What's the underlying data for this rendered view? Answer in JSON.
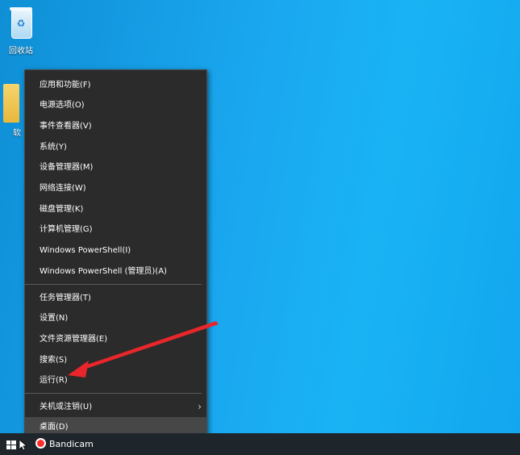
{
  "desktop": {
    "icons": [
      {
        "label": "回收站",
        "icon": "recycle-bin-icon"
      },
      {
        "label": "软",
        "icon": "folder-icon"
      }
    ]
  },
  "context_menu": {
    "items": [
      {
        "label": "应用和功能(F)"
      },
      {
        "label": "电源选项(O)"
      },
      {
        "label": "事件查看器(V)"
      },
      {
        "label": "系统(Y)"
      },
      {
        "label": "设备管理器(M)"
      },
      {
        "label": "网络连接(W)"
      },
      {
        "label": "磁盘管理(K)"
      },
      {
        "label": "计算机管理(G)"
      },
      {
        "label": "Windows PowerShell(I)"
      },
      {
        "label": "Windows PowerShell (管理员)(A)"
      },
      {
        "label": "任务管理器(T)"
      },
      {
        "label": "设置(N)"
      },
      {
        "label": "文件资源管理器(E)"
      },
      {
        "label": "搜索(S)"
      },
      {
        "label": "运行(R)"
      },
      {
        "label": "关机或注销(U)",
        "has_submenu": true
      },
      {
        "label": "桌面(D)",
        "highlighted": true
      }
    ]
  },
  "annotation": {
    "color": "#e8262b",
    "target": "运行(R)"
  },
  "taskbar": {
    "apps": [
      {
        "label": "Bandicam",
        "icon": "bandicam-record-icon"
      }
    ]
  },
  "colors": {
    "menu_background": "#2b2b2b",
    "menu_highlight": "#474747",
    "taskbar_background": "#1e262c",
    "desktop_accent": "#19b3f4"
  }
}
